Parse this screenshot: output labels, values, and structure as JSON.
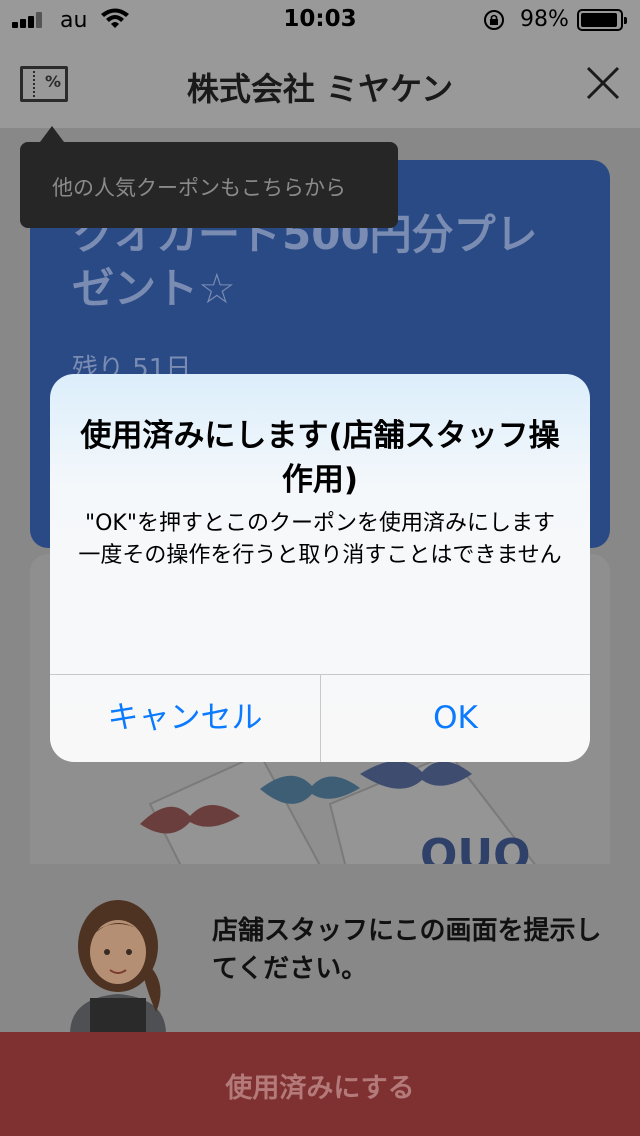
{
  "status_bar": {
    "carrier": "au",
    "time": "10:03",
    "battery_percent": "98%",
    "battery_level": 0.98
  },
  "header": {
    "coupon_icon_label": "%",
    "title": "株式会社 ミヤケン"
  },
  "tooltip": {
    "text": "他の人気クーポンもこちらから"
  },
  "coupon": {
    "title": "クオカード500円分プレゼント☆",
    "remaining": "残り 51日"
  },
  "alert": {
    "title": "使用済みにします(店舗スタッフ操作用)",
    "message_line1": "\"OK\"を押すとこのクーポンを使用済みにします",
    "message_line2": "一度その操作を行うと取り消すことはできません",
    "cancel_label": "キャンセル",
    "ok_label": "OK",
    "button_color": "#0a7aff"
  },
  "bottom": {
    "instruction": "店舗スタッフにこの画面を提示してください。",
    "use_button_label": "使用済みにする",
    "use_button_color": "#7e3130"
  }
}
